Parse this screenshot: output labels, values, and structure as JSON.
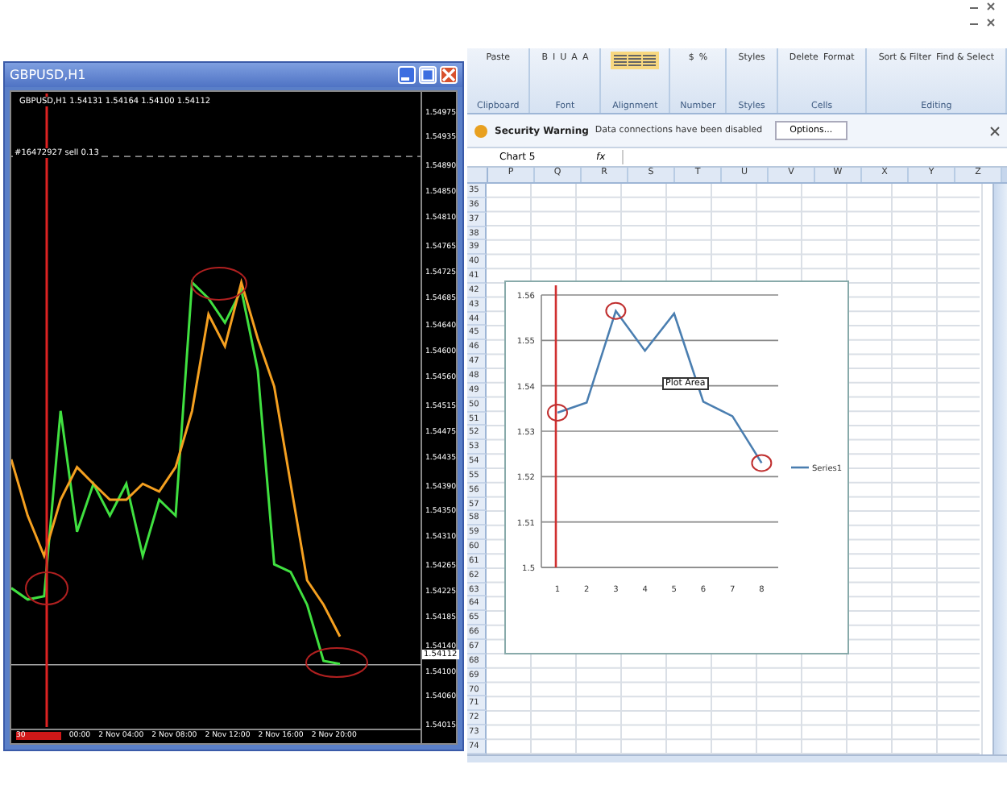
{
  "chart_window": {
    "title": "GBPUSD,H1",
    "header": "GBPUSD,H1  1.54131 1.54164 1.54100 1.54112",
    "order_label": "#16472927 sell 0.13",
    "current_price": "1.54112",
    "time_labels": [
      "30",
      "00:00",
      "2 Nov 04:00",
      "2 Nov 08:00",
      "2 Nov 12:00",
      "2 Nov 16:00",
      "2 Nov 20:00"
    ],
    "chart_data": {
      "type": "line",
      "ylim": [
        1.54012,
        1.55008
      ],
      "ref_lines": [
        {
          "axis": "y",
          "value": 1.54907,
          "color": "#888888"
        },
        {
          "axis": "y",
          "value": 1.54112,
          "color": "#aaaaaa"
        }
      ],
      "series": [
        {
          "color": "#40e040",
          "values": [
            1.54232,
            1.54214,
            1.54219,
            1.54509,
            1.5432,
            1.54395,
            1.54345,
            1.54395,
            1.54282,
            1.5437,
            1.54345,
            1.5471,
            1.54685,
            1.54647,
            1.54698,
            1.54572,
            1.54269,
            1.54257,
            1.54206,
            1.54118,
            1.54113
          ]
        },
        {
          "color": "#f5a020",
          "values": [
            1.54433,
            1.54345,
            1.54282,
            1.5437,
            1.54421,
            1.54395,
            1.5437,
            1.5437,
            1.54395,
            1.54383,
            1.54421,
            1.54509,
            1.5466,
            1.5461,
            1.5471,
            1.54622,
            1.54547,
            1.54395,
            1.54244,
            1.54206,
            1.54156
          ]
        }
      ],
      "yticks": [
        {
          "value": 1.54975,
          "label": "1.54975"
        },
        {
          "value": 1.54935,
          "label": "1.54935"
        },
        {
          "value": 1.5489,
          "label": "1.54890"
        },
        {
          "value": 1.5485,
          "label": "1.54850"
        },
        {
          "value": 1.5481,
          "label": "1.54810"
        },
        {
          "value": 1.54765,
          "label": "1.54765"
        },
        {
          "value": 1.54725,
          "label": "1.54725"
        },
        {
          "value": 1.54685,
          "label": "1.54685"
        },
        {
          "value": 1.5464,
          "label": "1.54640"
        },
        {
          "value": 1.546,
          "label": "1.54600"
        },
        {
          "value": 1.5456,
          "label": "1.54560"
        },
        {
          "value": 1.54515,
          "label": "1.54515"
        },
        {
          "value": 1.54475,
          "label": "1.54475"
        },
        {
          "value": 1.54435,
          "label": "1.54435"
        },
        {
          "value": 1.5439,
          "label": "1.54390"
        },
        {
          "value": 1.5435,
          "label": "1.54350"
        },
        {
          "value": 1.5431,
          "label": "1.54310"
        },
        {
          "value": 1.54265,
          "label": "1.54265"
        },
        {
          "value": 1.54225,
          "label": "1.54225"
        },
        {
          "value": 1.54185,
          "label": "1.54185"
        },
        {
          "value": 1.5414,
          "label": "1.54140"
        },
        {
          "value": 1.541,
          "label": "1.54100"
        },
        {
          "value": 1.5406,
          "label": "1.54060"
        },
        {
          "value": 1.54015,
          "label": "1.54015"
        }
      ]
    }
  },
  "excel": {
    "ribbon": [
      {
        "label": "Clipboard",
        "buttons": [
          "Paste"
        ]
      },
      {
        "label": "Font",
        "buttons": [
          "B",
          "I",
          "U",
          "A",
          "A"
        ]
      },
      {
        "label": "Alignment"
      },
      {
        "label": "Number",
        "buttons": [
          "$",
          "%"
        ]
      },
      {
        "label": "Styles",
        "buttons": [
          "Styles"
        ]
      },
      {
        "label": "Cells",
        "buttons": [
          "Delete",
          "Format"
        ]
      },
      {
        "label": "Editing",
        "buttons": [
          "Sort & Filter",
          "Find & Select"
        ]
      }
    ],
    "security_bar": {
      "title": "Security Warning",
      "message": "Data connections have been disabled",
      "button": "Options..."
    },
    "formula_bar": {
      "name_box": "Chart 5",
      "fx": "fx"
    },
    "columns": [
      "P",
      "Q",
      "R",
      "S",
      "T",
      "U",
      "V",
      "W",
      "X",
      "Y",
      "Z"
    ],
    "rows": [
      "35",
      "36",
      "37",
      "38",
      "39",
      "40",
      "41",
      "42",
      "43",
      "44",
      "45",
      "46",
      "47",
      "48",
      "49",
      "50",
      "51",
      "52",
      "53",
      "54",
      "55",
      "56",
      "57",
      "58",
      "59",
      "60",
      "61",
      "62",
      "63",
      "64",
      "65",
      "66",
      "67",
      "68",
      "69",
      "70",
      "71",
      "72",
      "73",
      "74"
    ],
    "chart": {
      "tooltip": "Plot Area",
      "chart_data": {
        "type": "line",
        "categories": [
          "1",
          "2",
          "3",
          "4",
          "5",
          "6",
          "7",
          "8"
        ],
        "series": [
          {
            "name": "Series1",
            "color": "#4a7eb0",
            "values": [
              1.5341,
              1.5363,
              1.5565,
              1.5477,
              1.5559,
              1.5365,
              1.5333,
              1.523
            ]
          }
        ],
        "ylim": [
          1.5,
          1.56
        ],
        "yticks": [
          1.5,
          1.51,
          1.52,
          1.53,
          1.54,
          1.55,
          1.56
        ],
        "grid": true,
        "ref_lines": [
          {
            "axis": "x",
            "value": "1",
            "color": "#d03030"
          }
        ]
      }
    }
  }
}
